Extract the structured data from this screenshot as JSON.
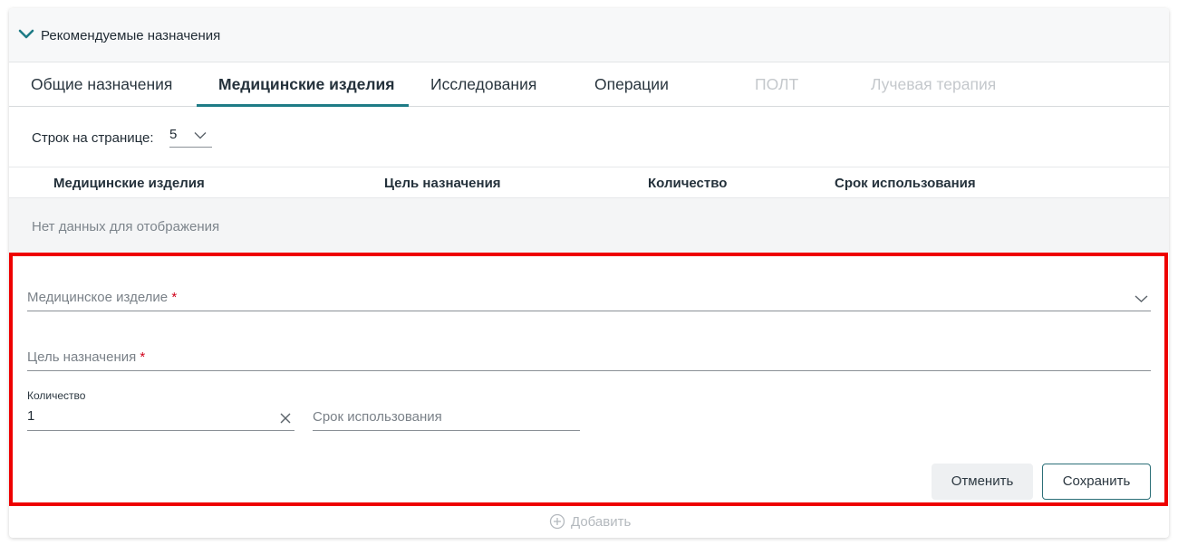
{
  "section": {
    "title": "Рекомендуемые назначения",
    "icon": "chevron-down-icon",
    "accent_color": "#1e7b86"
  },
  "tabs": [
    {
      "label": "Общие назначения",
      "state": "normal"
    },
    {
      "label": "Медицинские изделия",
      "state": "active"
    },
    {
      "label": "Исследования",
      "state": "normal"
    },
    {
      "label": "Операции",
      "state": "normal"
    },
    {
      "label": "ПОЛТ",
      "state": "disabled"
    },
    {
      "label": "Лучевая терапия",
      "state": "disabled"
    }
  ],
  "pagination": {
    "rows_label": "Строк на странице:",
    "rows_value": "5"
  },
  "table": {
    "columns": [
      "Медицинские изделия",
      "Цель назначения",
      "Количество",
      "Срок использования"
    ],
    "empty_text": "Нет данных для отображения"
  },
  "form": {
    "device_placeholder": "Медицинское изделие",
    "purpose_placeholder": "Цель назначения",
    "required_mark": "*",
    "quantity_label": "Количество",
    "quantity_value": "1",
    "usage_period_placeholder": "Срок использования",
    "cancel_label": "Отменить",
    "save_label": "Сохранить",
    "highlight_color": "#ee0000"
  },
  "add": {
    "label": "Добавить",
    "icon": "plus-circle-icon"
  }
}
